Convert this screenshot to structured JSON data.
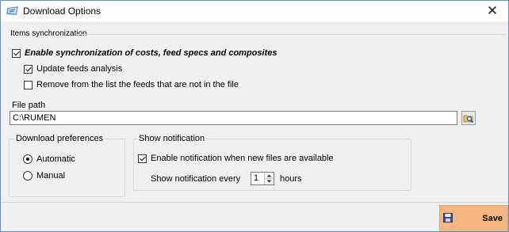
{
  "window": {
    "title": "Download Options",
    "close_glyph": "✕",
    "app_icon": "app-icon",
    "accent_border": "#5a8fd0"
  },
  "items_sync": {
    "section_title": "Items synchronization",
    "enable_sync": {
      "label": "Enable synchronization of costs, feed specs and composites",
      "checked": true
    },
    "update_feeds": {
      "label": "Update feeds analysis",
      "checked": true
    },
    "remove_feeds": {
      "label": "Remove from the list the feeds that are not in the file",
      "checked": false
    }
  },
  "file_path": {
    "label": "File path",
    "value": "C:\\RUMEN",
    "browse_icon": "folder-search-icon"
  },
  "download_preferences": {
    "title": "Download preferences",
    "options": [
      {
        "label": "Automatic",
        "selected": true
      },
      {
        "label": "Manual",
        "selected": false
      }
    ]
  },
  "show_notification": {
    "title": "Show notification",
    "enable": {
      "label": "Enable notification when new files are available",
      "checked": true
    },
    "every_label": "Show notification every",
    "every_value": "1",
    "unit": "hours"
  },
  "footer": {
    "save_label": "Save",
    "save_icon": "floppy-disk-icon",
    "save_color": "#f3b67f"
  }
}
